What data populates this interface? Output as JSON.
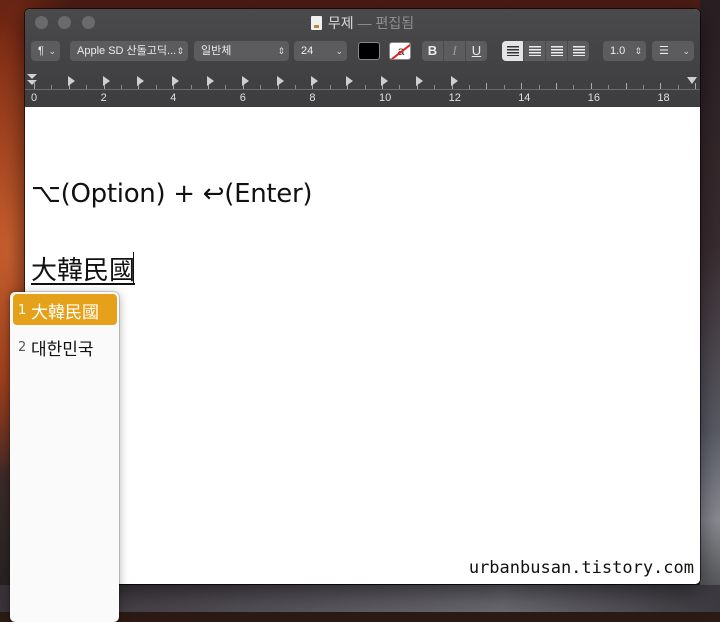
{
  "window": {
    "title": "무제",
    "title_suffix": "— 편집됨"
  },
  "toolbar": {
    "paragraph_style": "¶",
    "font_family": "Apple SD 산돌고딕...",
    "font_style": "일반체",
    "font_size": "24",
    "text_color": "#000000",
    "bold_label": "B",
    "italic_label": "I",
    "underline_label": "U",
    "line_spacing": "1.0",
    "list_label": "☰"
  },
  "ruler": {
    "numbers": [
      "0",
      "2",
      "4",
      "6",
      "8",
      "10",
      "12",
      "14",
      "16",
      "18"
    ]
  },
  "document": {
    "line1": "⌥(Option) + ↩(Enter)",
    "line2": "大韓民國",
    "watermark": "urbanbusan.tistory.com"
  },
  "candidates": [
    {
      "number": "1",
      "text": "大韓民國",
      "selected": true
    },
    {
      "number": "2",
      "text": "대한민국",
      "selected": false
    }
  ],
  "colors": {
    "selection": "#e6a11a",
    "titlebar": "#3d3d3f"
  }
}
